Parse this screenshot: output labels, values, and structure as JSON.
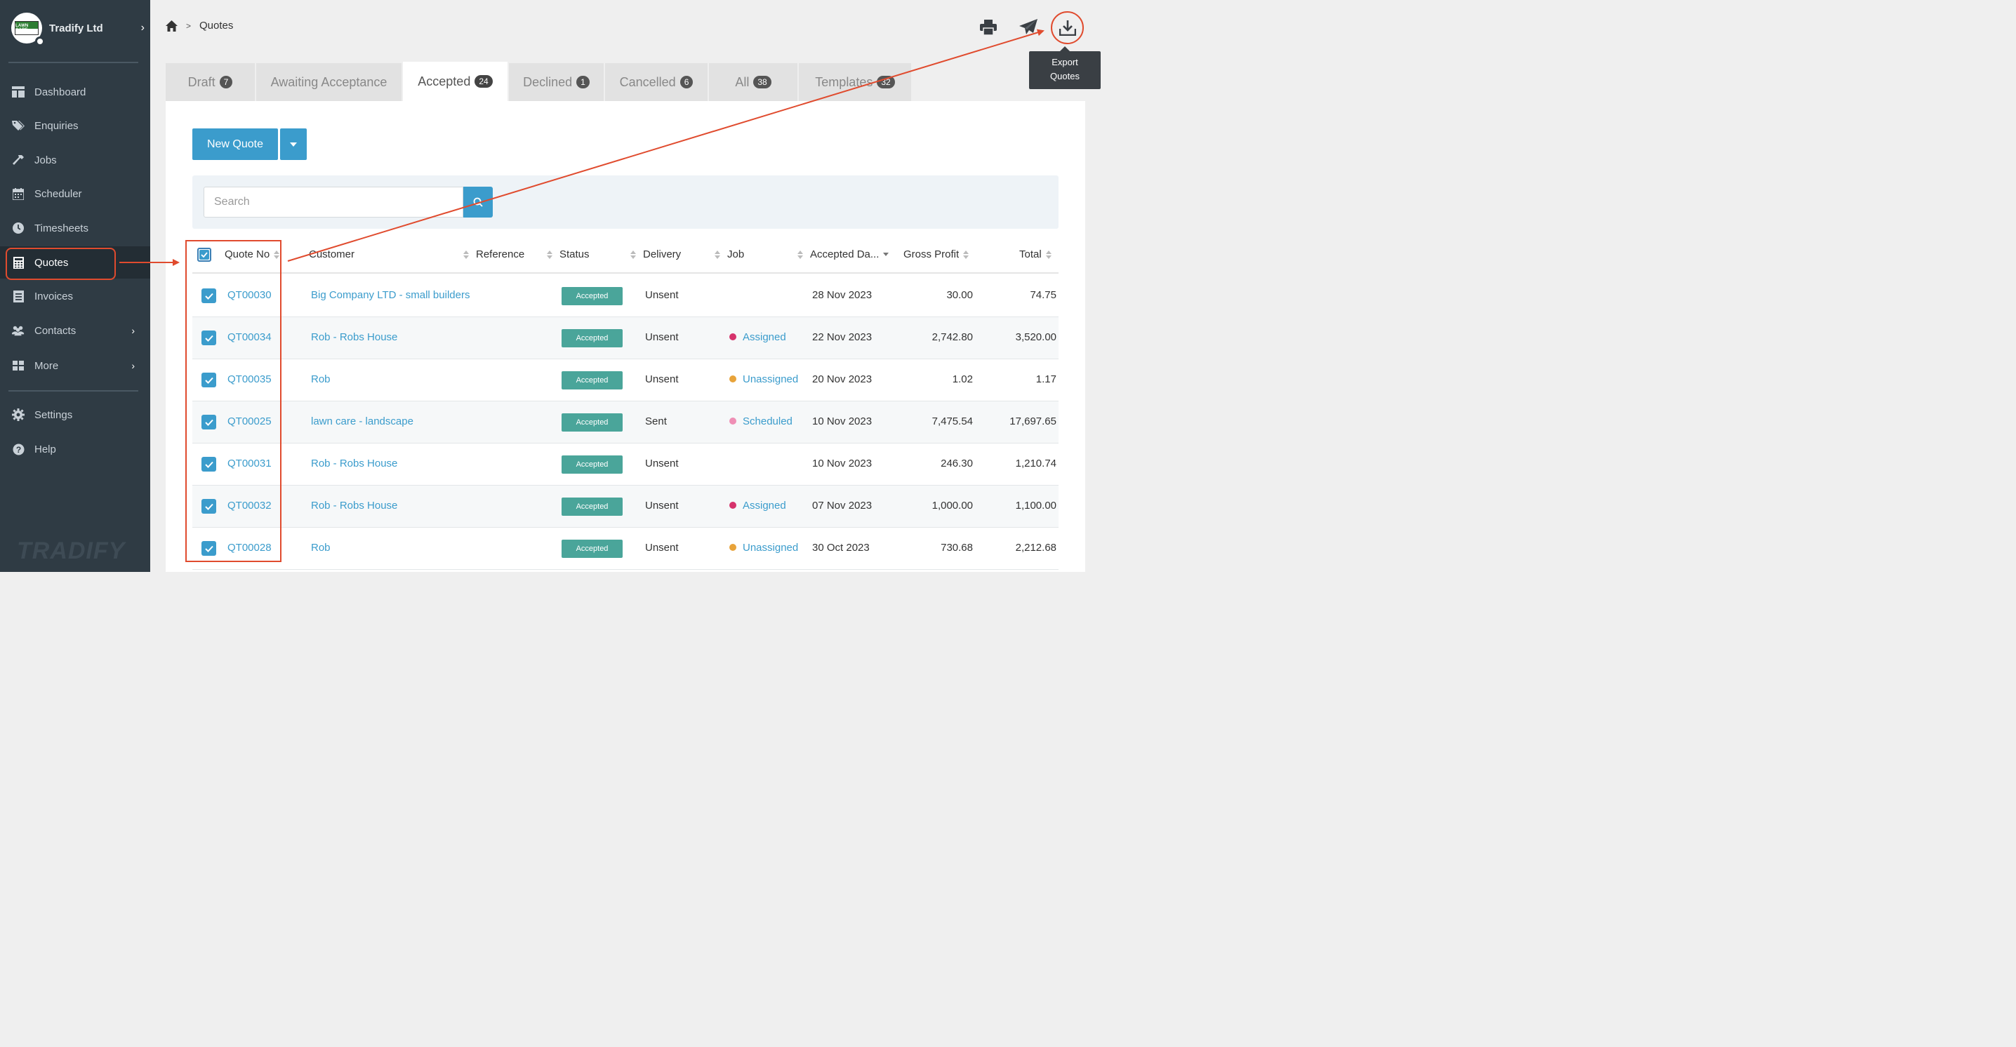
{
  "sidebar": {
    "brand_name": "Tradify Ltd",
    "logo_text": "LAWN CARE",
    "footer_mark": "TRADIFY",
    "items": [
      {
        "key": "dashboard",
        "label": "Dashboard",
        "icon": "dashboard-icon"
      },
      {
        "key": "enquiries",
        "label": "Enquiries",
        "icon": "tags-icon"
      },
      {
        "key": "jobs",
        "label": "Jobs",
        "icon": "hammer-icon"
      },
      {
        "key": "scheduler",
        "label": "Scheduler",
        "icon": "calendar-icon"
      },
      {
        "key": "timesheets",
        "label": "Timesheets",
        "icon": "clock-icon"
      },
      {
        "key": "quotes",
        "label": "Quotes",
        "icon": "calculator-icon"
      },
      {
        "key": "invoices",
        "label": "Invoices",
        "icon": "invoice-icon"
      },
      {
        "key": "contacts",
        "label": "Contacts",
        "icon": "users-icon"
      },
      {
        "key": "more",
        "label": "More",
        "icon": "grid-icon"
      },
      {
        "key": "settings",
        "label": "Settings",
        "icon": "gear-icon"
      },
      {
        "key": "help",
        "label": "Help",
        "icon": "question-icon"
      }
    ]
  },
  "breadcrumb": {
    "current": "Quotes"
  },
  "header": {
    "tooltip_line1": "Export",
    "tooltip_line2": "Quotes"
  },
  "tabs": [
    {
      "label": "Draft",
      "count": "7"
    },
    {
      "label": "Awaiting Acceptance",
      "count": ""
    },
    {
      "label": "Accepted",
      "count": "24"
    },
    {
      "label": "Declined",
      "count": "1"
    },
    {
      "label": "Cancelled",
      "count": "6"
    },
    {
      "label": "All",
      "count": "38"
    },
    {
      "label": "Templates",
      "count": "32"
    }
  ],
  "actions": {
    "new_quote": "New Quote"
  },
  "search": {
    "placeholder": "Search",
    "value": ""
  },
  "table": {
    "columns": {
      "quote_no": "Quote No",
      "customer": "Customer",
      "reference": "Reference",
      "status": "Status",
      "delivery": "Delivery",
      "job": "Job",
      "accepted_date": "Accepted Da...",
      "gross_profit": "Gross Profit",
      "total": "Total"
    },
    "rows": [
      {
        "quote_no": "QT00030",
        "customer": "Big Company LTD - small builders",
        "status": "Accepted",
        "delivery": "Unsent",
        "job": "",
        "job_color": "",
        "accepted_date": "28 Nov 2023",
        "gross_profit": "30.00",
        "total": "74.75"
      },
      {
        "quote_no": "QT00034",
        "customer": "Rob - Robs House",
        "status": "Accepted",
        "delivery": "Unsent",
        "job": "Assigned",
        "job_color": "#d6336c",
        "accepted_date": "22 Nov 2023",
        "gross_profit": "2,742.80",
        "total": "3,520.00"
      },
      {
        "quote_no": "QT00035",
        "customer": "Rob",
        "status": "Accepted",
        "delivery": "Unsent",
        "job": "Unassigned",
        "job_color": "#e8a33a",
        "accepted_date": "20 Nov 2023",
        "gross_profit": "1.02",
        "total": "1.17"
      },
      {
        "quote_no": "QT00025",
        "customer": "lawn care - landscape",
        "status": "Accepted",
        "delivery": "Sent",
        "job": "Scheduled",
        "job_color": "#ef8fb5",
        "accepted_date": "10 Nov 2023",
        "gross_profit": "7,475.54",
        "total": "17,697.65"
      },
      {
        "quote_no": "QT00031",
        "customer": "Rob - Robs House",
        "status": "Accepted",
        "delivery": "Unsent",
        "job": "",
        "job_color": "",
        "accepted_date": "10 Nov 2023",
        "gross_profit": "246.30",
        "total": "1,210.74"
      },
      {
        "quote_no": "QT00032",
        "customer": "Rob - Robs House",
        "status": "Accepted",
        "delivery": "Unsent",
        "job": "Assigned",
        "job_color": "#d6336c",
        "accepted_date": "07 Nov 2023",
        "gross_profit": "1,000.00",
        "total": "1,100.00"
      },
      {
        "quote_no": "QT00028",
        "customer": "Rob",
        "status": "Accepted",
        "delivery": "Unsent",
        "job": "Unassigned",
        "job_color": "#e8a33a",
        "accepted_date": "30 Oct 2023",
        "gross_profit": "730.68",
        "total": "2,212.68"
      }
    ]
  },
  "colors": {
    "accent": "#3b9ccc",
    "annotation": "#e04b2e",
    "status_accepted": "#4aa59a",
    "sidebar_bg": "#2f3b44"
  }
}
